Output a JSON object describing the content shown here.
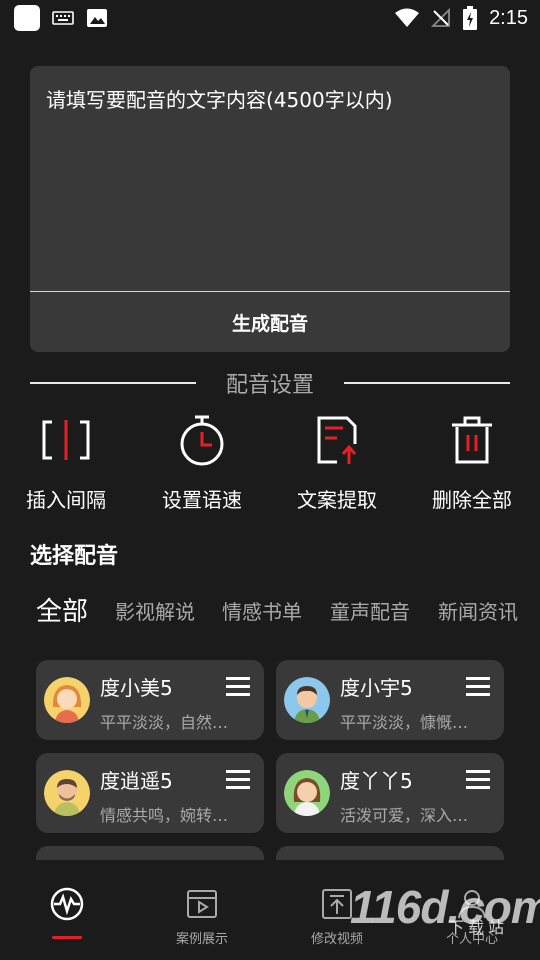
{
  "status_bar": {
    "time": "2:15",
    "icons": [
      "app-icon",
      "keyboard-icon",
      "image-icon",
      "wifi-icon",
      "no-signal-icon",
      "battery-charging-icon"
    ]
  },
  "editor": {
    "placeholder": "请填写要配音的文字内容(4500字以内)",
    "generate_label": "生成配音"
  },
  "settings": {
    "title": "配音设置",
    "tools": [
      {
        "label": "插入间隔",
        "icon": "insert-pause-icon"
      },
      {
        "label": "设置语速",
        "icon": "stopwatch-icon"
      },
      {
        "label": "文案提取",
        "icon": "document-extract-icon"
      },
      {
        "label": "删除全部",
        "icon": "trash-icon"
      }
    ]
  },
  "voices": {
    "title": "选择配音",
    "categories": [
      {
        "label": "全部",
        "active": true
      },
      {
        "label": "影视解说",
        "active": false
      },
      {
        "label": "情感书单",
        "active": false
      },
      {
        "label": "童声配音",
        "active": false
      },
      {
        "label": "新闻资讯",
        "active": false
      }
    ],
    "items": [
      {
        "name": "度小美5",
        "desc": "平平淡淡，自然…",
        "avatar": "female-avatar-orange"
      },
      {
        "name": "度小宇5",
        "desc": "平平淡淡，慷慨…",
        "avatar": "male-avatar-blue"
      },
      {
        "name": "度逍遥5",
        "desc": "情感共鸣，婉转…",
        "avatar": "male-avatar-yellow"
      },
      {
        "name": "度丫丫5",
        "desc": "活泼可爱，深入…",
        "avatar": "female-avatar-green"
      }
    ]
  },
  "bottom_nav": {
    "items": [
      {
        "label": "",
        "icon": "waveform-icon",
        "active": true
      },
      {
        "label": "案例展示",
        "icon": "video-play-icon",
        "active": false
      },
      {
        "label": "修改视频",
        "icon": "upload-icon",
        "active": false
      },
      {
        "label": "个人中心",
        "icon": "person-icon",
        "active": false
      }
    ]
  },
  "watermark": {
    "text": "116d.com",
    "sub": "下载站"
  },
  "colors": {
    "background": "#1c1b1c",
    "card": "#3a393a",
    "accent": "#e32025",
    "muted": "#a9a9a9"
  }
}
